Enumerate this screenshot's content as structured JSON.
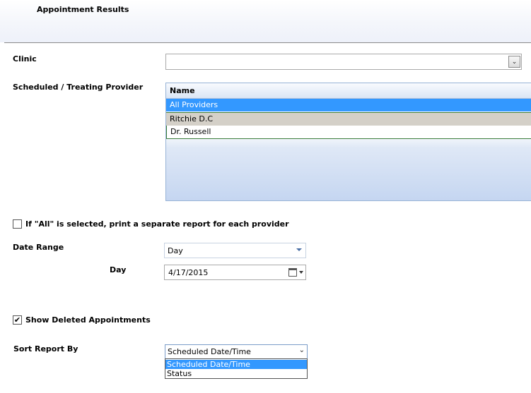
{
  "header": {
    "title": "Appointment Results"
  },
  "clinic": {
    "label": "Clinic",
    "value": ""
  },
  "provider": {
    "label": "Scheduled / Treating Provider",
    "column_header": "Name",
    "rows": [
      "All Providers",
      "Ritchie D.C",
      "Dr. Russell"
    ]
  },
  "separate_report": {
    "label": "If \"All\" is selected, print a separate report for each provider",
    "checked": false
  },
  "date_range": {
    "label": "Date Range",
    "value": "Day"
  },
  "day": {
    "label": "Day",
    "value": "4/17/2015"
  },
  "show_deleted": {
    "label": "Show Deleted Appointments",
    "checked": true,
    "mark": "✔"
  },
  "sort": {
    "label": "Sort Report By",
    "value": "Scheduled Date/Time",
    "options": [
      "Scheduled Date/Time",
      "Status"
    ]
  },
  "icons": {
    "combo_arrow": "▾",
    "sort_arrow": "⌄"
  }
}
